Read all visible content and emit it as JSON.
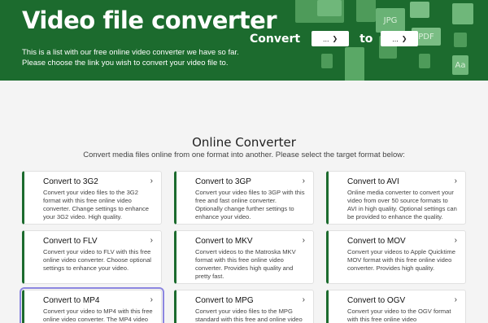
{
  "header": {
    "title": "Video file converter",
    "subtitle": "This is a list with our free online video converter we have so far. Please choose the link you wish to convert your video file to.",
    "convert_label": "Convert",
    "to_label": "to",
    "from_select": "...",
    "to_select": "...",
    "deco_labels": {
      "jpg": "JPG",
      "pdf": "PDF",
      "aa": "Aa"
    }
  },
  "main": {
    "title": "Online Converter",
    "subtitle": "Convert media files online from one format into another. Please select the target format below:"
  },
  "cards": [
    {
      "title": "Convert to 3G2",
      "desc": "Convert your video files to the 3G2 format with this free online video converter. Change settings to enhance your 3G2 video. High quality."
    },
    {
      "title": "Convert to 3GP",
      "desc": "Convert your video files to 3GP with this free and fast online converter. Optionally change further settings to enhance your video."
    },
    {
      "title": "Convert to AVI",
      "desc": "Online media converter to convert your video from over 50 source formats to AVI in high quality. Optional settings can be provided to enhance the quality."
    },
    {
      "title": "Convert to FLV",
      "desc": "Convert your video to FLV with this free online video converter. Choose optional settings to enhance your video."
    },
    {
      "title": "Convert to MKV",
      "desc": "Convert videos to the Matroska MKV format with this free online video converter. Provides high quality and pretty fast."
    },
    {
      "title": "Convert to MOV",
      "desc": "Convert your videos to Apple Quicktime MOV format with this free online video converter. Provides high quality."
    },
    {
      "title": "Convert to MP4",
      "desc": "Convert your video to MP4 with this free online video converter. The MP4 video"
    },
    {
      "title": "Convert to MPG",
      "desc": "Convert your video files to the MPG standard with this free and online video"
    },
    {
      "title": "Convert to OGV",
      "desc": "Convert your video to the OGV format with this free online video"
    }
  ],
  "colors": {
    "brand_green": "#1c6b2e",
    "highlight": "#8c86e0",
    "background": "#f4f4f4"
  }
}
